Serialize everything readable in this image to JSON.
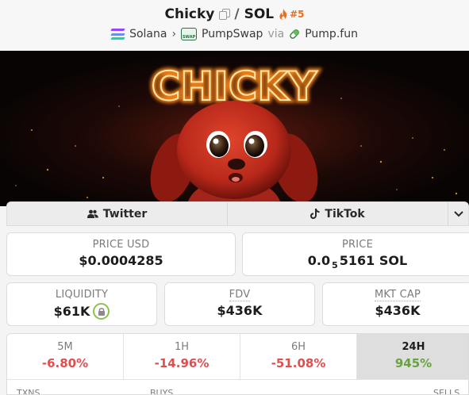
{
  "header": {
    "token_name": "Chicky",
    "quote": "SOL",
    "separator": "/",
    "rank": "#5",
    "chain": "Solana",
    "dex": "PumpSwap",
    "via_label": "via",
    "launchpad": "Pump.fun"
  },
  "banner": {
    "title_text": "CHICKY"
  },
  "socials": {
    "twitter": "Twitter",
    "tiktok": "TikTok"
  },
  "stats": {
    "price_usd_label": "PRICE USD",
    "price_usd_value": "$0.0004285",
    "price_label": "PRICE",
    "price_prefix": "0.0",
    "price_zeros": "5",
    "price_suffix": "5161 SOL",
    "liquidity_label": "LIQUIDITY",
    "liquidity_value": "$61K",
    "fdv_label": "FDV",
    "fdv_value": "$436K",
    "mktcap_label": "MKT CAP",
    "mktcap_value": "$436K"
  },
  "timeframes": [
    {
      "label": "5M",
      "value": "-6.80%"
    },
    {
      "label": "1H",
      "value": "-14.96%"
    },
    {
      "label": "6H",
      "value": "-51.08%"
    },
    {
      "label": "24H",
      "value": "945%"
    }
  ],
  "txns_row": {
    "txns": "TXNS",
    "buys": "BUYS",
    "sells": "SELLS"
  },
  "colors": {
    "negative": "#e04f4f",
    "positive": "#67a33f",
    "rank": "#f06b1a"
  }
}
